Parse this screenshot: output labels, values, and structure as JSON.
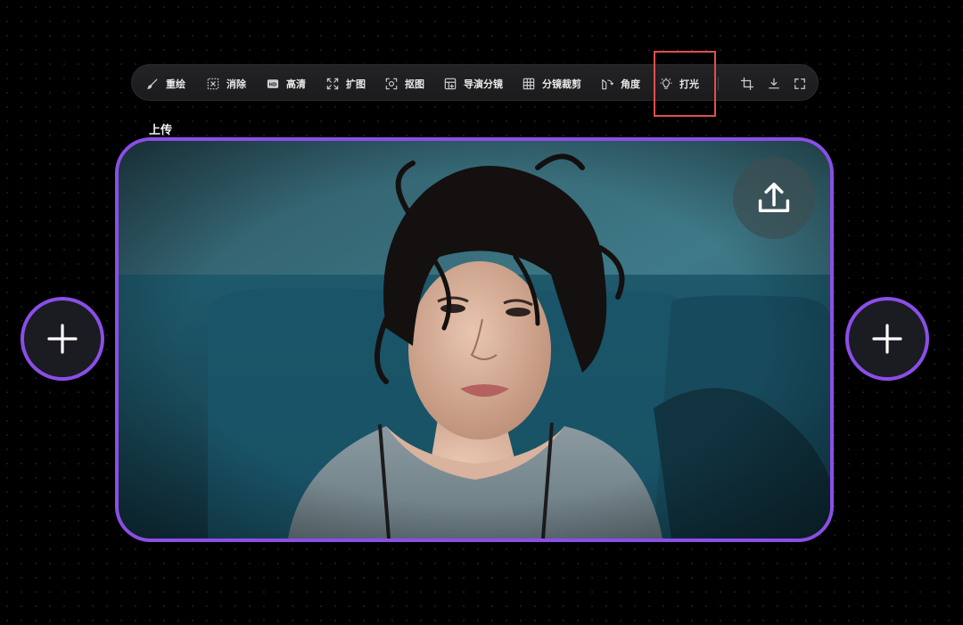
{
  "toolbar": {
    "items": [
      {
        "label": "重绘",
        "icon": "brush-icon"
      },
      {
        "label": "消除",
        "icon": "erase-icon"
      },
      {
        "label": "高清",
        "icon": "hd-icon"
      },
      {
        "label": "扩图",
        "icon": "expand-icon"
      },
      {
        "label": "抠图",
        "icon": "cutout-icon"
      },
      {
        "label": "导演分镜",
        "icon": "storyboard-icon"
      },
      {
        "label": "分镜裁剪",
        "icon": "grid-crop-icon"
      },
      {
        "label": "角度",
        "icon": "angle-icon"
      },
      {
        "label": "打光",
        "icon": "lightbulb-icon"
      }
    ],
    "actions": [
      {
        "icon": "crop-icon"
      },
      {
        "icon": "download-icon"
      },
      {
        "icon": "fullscreen-icon"
      }
    ]
  },
  "upload_label": "上传",
  "canvas": {
    "upload_icon": "upload-icon",
    "add_icon": "plus-icon"
  },
  "colors": {
    "accent": "#8b4ee8",
    "highlight": "#e0504a",
    "background": "#000000",
    "toolbar_bg": "#1f1f22"
  }
}
